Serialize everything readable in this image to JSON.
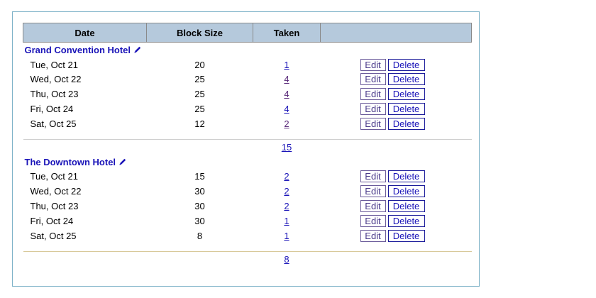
{
  "table": {
    "headers": {
      "date": "Date",
      "block_size": "Block Size",
      "taken": "Taken",
      "actions": ""
    },
    "edit_label": "Edit",
    "delete_label": "Delete"
  },
  "hotels": [
    {
      "name": "Grand Convention Hotel",
      "rows": [
        {
          "date": "Tue, Oct 21",
          "block_size": "20",
          "taken": "1"
        },
        {
          "date": "Wed, Oct 22",
          "block_size": "25",
          "taken": "4"
        },
        {
          "date": "Thu, Oct 23",
          "block_size": "25",
          "taken": "4"
        },
        {
          "date": "Fri, Oct 24",
          "block_size": "25",
          "taken": "4"
        },
        {
          "date": "Sat, Oct 25",
          "block_size": "12",
          "taken": "2"
        }
      ],
      "total_taken": "15"
    },
    {
      "name": "The Downtown Hotel",
      "rows": [
        {
          "date": "Tue, Oct 21",
          "block_size": "15",
          "taken": "2"
        },
        {
          "date": "Wed, Oct 22",
          "block_size": "30",
          "taken": "2"
        },
        {
          "date": "Thu, Oct 23",
          "block_size": "30",
          "taken": "2"
        },
        {
          "date": "Fri, Oct 24",
          "block_size": "30",
          "taken": "1"
        },
        {
          "date": "Sat, Oct 25",
          "block_size": "8",
          "taken": "1"
        }
      ],
      "total_taken": "8"
    }
  ],
  "colors": {
    "header_bg": "#b5c9dc",
    "link": "#1a14b8",
    "panel_border": "#7fb3c8"
  },
  "icons": {
    "hotel_edit": "pencil-icon"
  }
}
